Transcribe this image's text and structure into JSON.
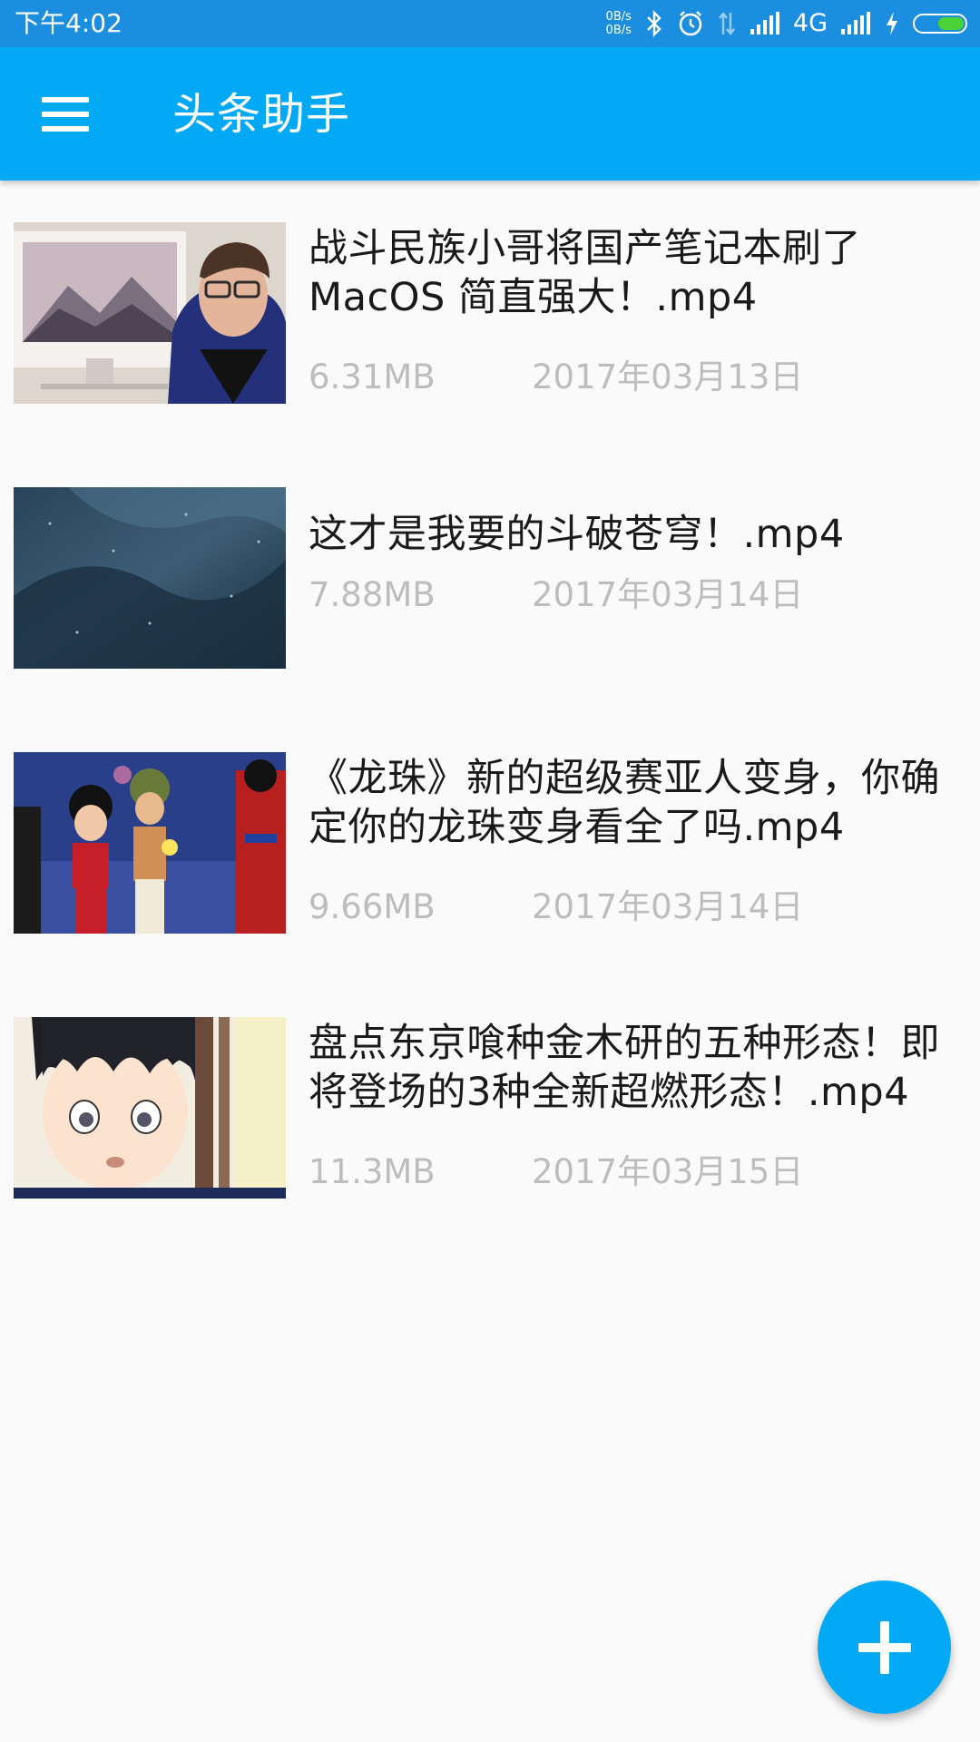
{
  "status_bar": {
    "time": "下午4:02",
    "net_up": "0B/s",
    "net_down": "0B/s",
    "network_type": "4G",
    "icons": [
      "bluetooth-icon",
      "alarm-icon",
      "data-arrows-icon",
      "signal-icon",
      "signal-icon",
      "charging-icon",
      "battery-icon"
    ],
    "battery_color": "#4cd137"
  },
  "app_bar": {
    "title": "头条助手",
    "menu_icon": "hamburger-menu-icon",
    "background": "#03a9f4"
  },
  "videos": [
    {
      "title": "战斗民族小哥将国产笔记本刷了\nMacOS 简直强大！.mp4",
      "size": "6.31MB",
      "date": "2017年03月13日",
      "thumbnail": "man-with-laptop-thumbnail"
    },
    {
      "title": "这才是我要的斗破苍穹！.mp4",
      "size": "7.88MB",
      "date": "2017年03月14日",
      "thumbnail": "dark-blue-texture-thumbnail"
    },
    {
      "title": "《龙珠》新的超级赛亚人变身，你确\n定你的龙珠变身看全了吗.mp4",
      "size": "9.66MB",
      "date": "2017年03月14日",
      "thumbnail": "anime-group-thumbnail"
    },
    {
      "title": "盘点东京喰种金木研的五种形态！即\n将登场的3种全新超燃形态！.mp4",
      "size": "11.3MB",
      "date": "2017年03月15日",
      "thumbnail": "anime-boy-thumbnail"
    }
  ],
  "fab": {
    "icon": "plus-icon",
    "color": "#03a9f4"
  }
}
